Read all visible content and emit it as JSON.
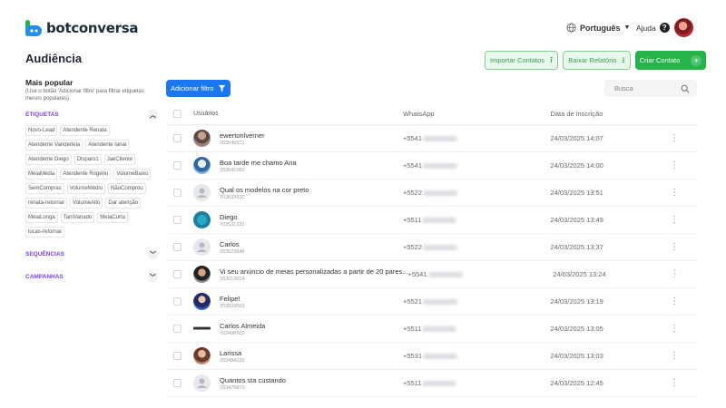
{
  "brand": {
    "name": "botconversa"
  },
  "header": {
    "language": "Português",
    "help": "Ajuda",
    "help_symbol": "?"
  },
  "page": {
    "title": "Audiência"
  },
  "actions": {
    "import": "Importar Contatos",
    "report": "Baixar Relatório",
    "create": "Criar Contato"
  },
  "sidebar": {
    "title": "Mais popular",
    "subtitle": "(Use o botão 'Adicionar filtro' para filtrar etiquetas menos populares)",
    "sections": {
      "tags": "ETIQUETAS",
      "sequences": "SEQUÊNCIAS",
      "campaigns": "CAMPANHAS"
    },
    "tags": [
      "Novo-Lead",
      "Atendente Renata",
      "Atendente Vanderleia",
      "Atendente Ianai",
      "Atendente Diego",
      "Disparo1",
      "JaéCliente",
      "MeiaMédia",
      "Atendente Rogério",
      "VolumeBaixo",
      "SemCompras",
      "VolumeMédio",
      "NãoComprou",
      "renata-retornar",
      "VolumeAlto",
      "Dar atenção",
      "MeiaLonga",
      "TamVariado",
      "MeiaCurta",
      "lucas-retornar"
    ]
  },
  "toolbar": {
    "filter": "Adicionar filtro",
    "search_placeholder": "Busca"
  },
  "table": {
    "headers": {
      "user": "Usuários",
      "whatsapp": "WhatsApp",
      "date": "Data de inscrição"
    },
    "rows": [
      {
        "name": "ewertonlverner",
        "id": "703545971",
        "phone": "+5541",
        "date": "24/03/2025 14:07",
        "avatar": "photo"
      },
      {
        "name": "Boa tarde me chamo Ana",
        "id": "703541060",
        "phone": "+5541",
        "date": "24/03/2025 14:00",
        "avatar": "photo"
      },
      {
        "name": "Qual os modelos na cor preto",
        "id": "703532632",
        "phone": "+5522",
        "date": "24/03/2025 13:51",
        "avatar": "placeholder"
      },
      {
        "name": "Diego",
        "id": "703531332",
        "phone": "+5511",
        "date": "24/03/2025 13:49",
        "avatar": "photo"
      },
      {
        "name": "Carlos",
        "id": "703523648",
        "phone": "+5522",
        "date": "24/03/2025 13:37",
        "avatar": "placeholder"
      },
      {
        "name": "Vi seu anúncio de meias personalizadas a partir de 20 pares...",
        "id": "703513614",
        "phone": "+5541",
        "date": "24/03/2025 13:24",
        "avatar": "photo"
      },
      {
        "name": "Felipe!",
        "id": "703509093",
        "phone": "+5521",
        "date": "24/03/2025 13:19",
        "avatar": "photo"
      },
      {
        "name": "Carlos Almeida",
        "id": "703496502",
        "phone": "+5511",
        "date": "24/03/2025 13:05",
        "avatar": "photo"
      },
      {
        "name": "Larissa",
        "id": "703484126",
        "phone": "+5531",
        "date": "24/03/2025 13:03",
        "avatar": "photo"
      },
      {
        "name": "Quantos sta custando",
        "id": "703479870",
        "phone": "+5511",
        "date": "24/03/2025 12:45",
        "avatar": "placeholder"
      }
    ]
  }
}
